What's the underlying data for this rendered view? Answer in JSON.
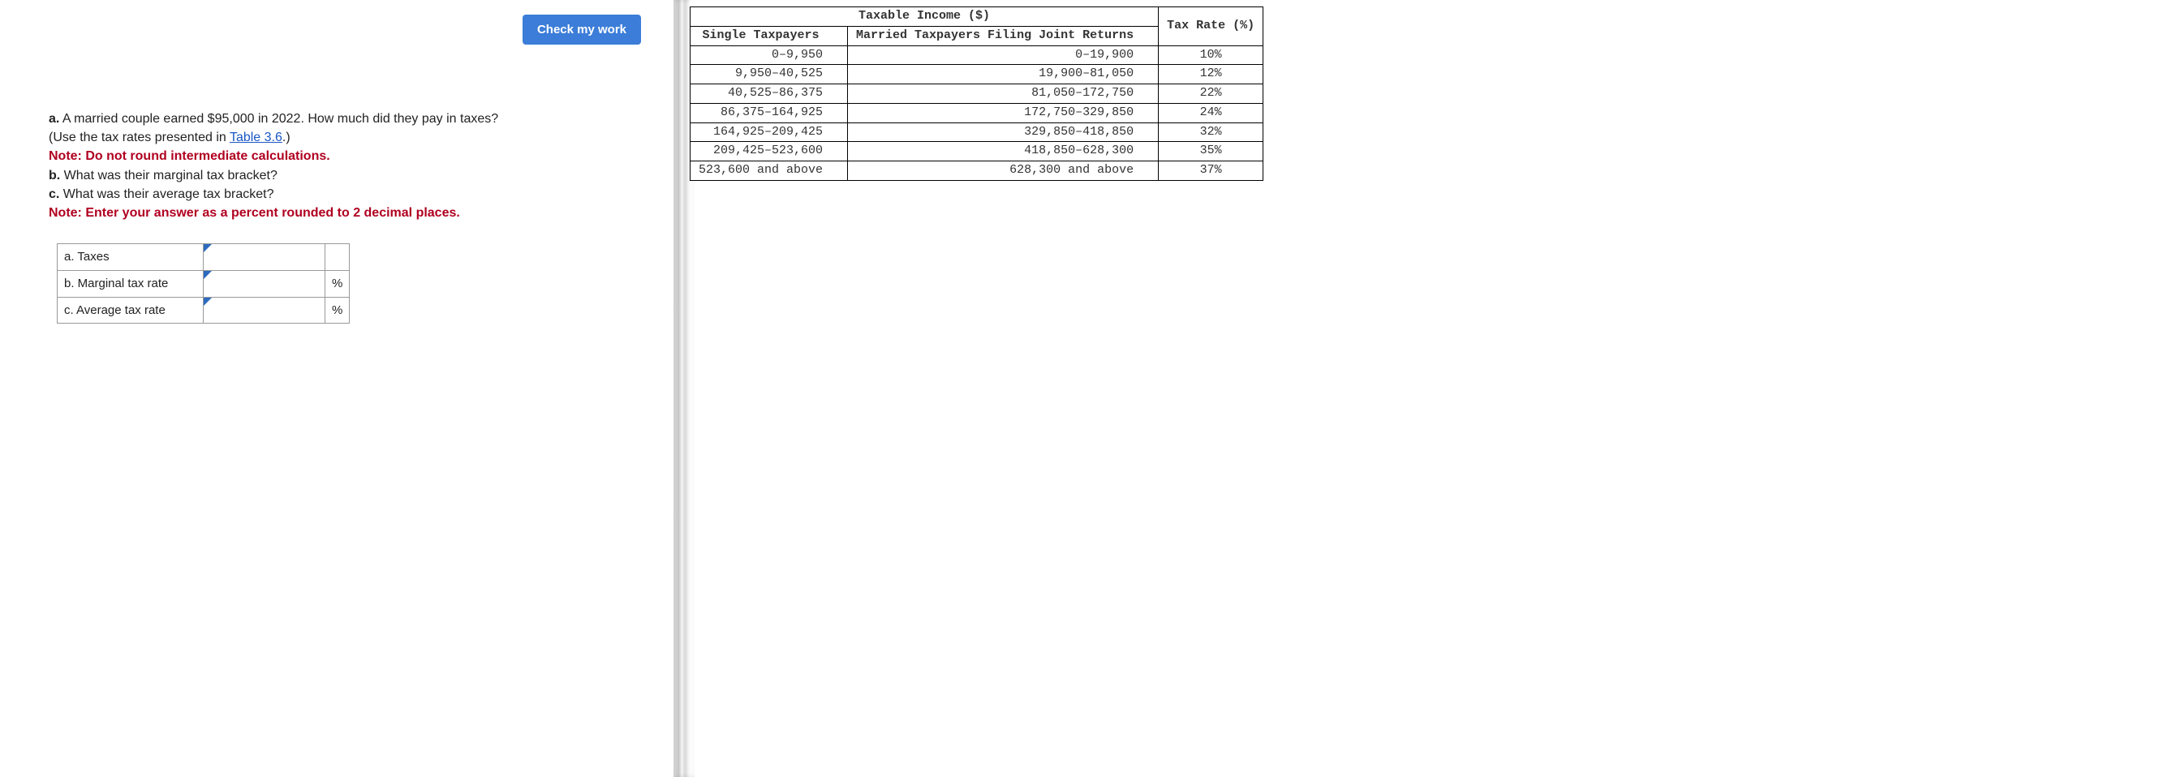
{
  "left": {
    "check_button": "Check my work",
    "questions": {
      "a_label": "a.",
      "a_text_1": " A married couple earned $95,000 in 2022. How much did they pay in taxes?",
      "a_text_2_prefix": "(Use the tax rates presented in ",
      "a_link": "Table 3.6",
      "a_text_2_suffix": ".)",
      "a_note": "Note: Do not round intermediate calculations.",
      "b_label": "b.",
      "b_text": " What was their marginal tax bracket?",
      "c_label": "c.",
      "c_text": " What was their average tax bracket?",
      "c_note": "Note: Enter your answer as a percent rounded to 2 decimal places."
    },
    "answer_rows": {
      "a_label": "a. Taxes",
      "b_label": "b. Marginal tax rate",
      "c_label": "c. Average tax rate",
      "pct": "%"
    }
  },
  "tax_table": {
    "title": "Taxable Income ($)",
    "col_single": "Single Taxpayers",
    "col_married": "Married Taxpayers Filing Joint Returns",
    "col_rate": "Tax Rate (%)",
    "rows": [
      {
        "single": "0–9,950",
        "married": "0–19,900",
        "rate": "10%"
      },
      {
        "single": "9,950–40,525",
        "married": "19,900–81,050",
        "rate": "12%"
      },
      {
        "single": "40,525–86,375",
        "married": "81,050–172,750",
        "rate": "22%"
      },
      {
        "single": "86,375–164,925",
        "married": "172,750–329,850",
        "rate": "24%"
      },
      {
        "single": "164,925–209,425",
        "married": "329,850–418,850",
        "rate": "32%"
      },
      {
        "single": "209,425–523,600",
        "married": "418,850–628,300",
        "rate": "35%"
      },
      {
        "single": "523,600 and above",
        "married": "628,300 and above",
        "rate": "37%"
      }
    ]
  },
  "chart_data": {
    "type": "table",
    "title": "Taxable Income ($)",
    "columns": [
      "Single Taxpayers",
      "Married Taxpayers Filing Joint Returns",
      "Tax Rate (%)"
    ],
    "rows": [
      [
        "0–9,950",
        "0–19,900",
        "10%"
      ],
      [
        "9,950–40,525",
        "19,900–81,050",
        "12%"
      ],
      [
        "40,525–86,375",
        "81,050–172,750",
        "22%"
      ],
      [
        "86,375–164,925",
        "172,750–329,850",
        "24%"
      ],
      [
        "164,925–209,425",
        "329,850–418,850",
        "32%"
      ],
      [
        "209,425–523,600",
        "418,850–628,300",
        "35%"
      ],
      [
        "523,600 and above",
        "628,300 and above",
        "37%"
      ]
    ]
  }
}
